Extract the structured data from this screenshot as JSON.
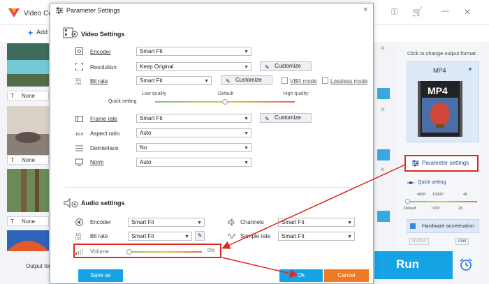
{
  "app": {
    "title": "Video Co",
    "add_files": "Add F",
    "thumb_none_label": "None",
    "output_folder": "Output fold",
    "right_panel": {
      "click_to_change": "Click to change output format:",
      "format": "MP4",
      "format_badge": "MP4",
      "parameter_settings": "Parameter settings",
      "quick_setting": "Quick setting",
      "quick_ticks_top": [
        "480P",
        "1080P",
        "4K"
      ],
      "quick_ticks_bottom": [
        "Default",
        "720P",
        "2K"
      ],
      "hardware_acceleration": "Hardware acceleration",
      "nvidia": "NVIDIA",
      "intel": "Intel"
    },
    "run": "Run"
  },
  "dialog": {
    "title": "Parameter Settings",
    "close": "×",
    "video": {
      "section": "Video Settings",
      "encoder": {
        "label": "Encoder",
        "value": "Smart Fit"
      },
      "resolution": {
        "label": "Resolution",
        "value": "Keep Original",
        "button": "Customize"
      },
      "bitrate": {
        "label": "Bit rate",
        "value": "Smart Fit",
        "button": "Customize",
        "vbr": "VBR mode",
        "lossless": "Lossless mode"
      },
      "quick": {
        "label": "Quick setting",
        "low": "Low quality",
        "default": "Default",
        "high": "High quality",
        "level": 0.5
      },
      "framerate": {
        "label": "Frame rate",
        "value": "Smart Fit",
        "button": "Customize"
      },
      "aspect": {
        "label": "Aspect ratio",
        "value": "Auto"
      },
      "deinterlace": {
        "label": "Deinterlace",
        "value": "No"
      },
      "norm": {
        "label": "Norm",
        "value": "Auto"
      }
    },
    "audio": {
      "section": "Audio settings",
      "encoder": {
        "label": "Encoder",
        "value": "Smart Fit"
      },
      "bitrate": {
        "label": "Bit rate",
        "value": "Smart Fit"
      },
      "channels": {
        "label": "Channels",
        "value": "Smart Fit"
      },
      "samplerate": {
        "label": "Sample rate",
        "value": "Smart Fit"
      },
      "volume": {
        "label": "Volume",
        "value": "0%",
        "level": 0.0
      }
    },
    "save_as": "Save as",
    "ok": "Ok",
    "cancel": "Cancel"
  },
  "colors": {
    "accent": "#16a3e6",
    "highlight": "#e0281f",
    "cancel": "#f07a23"
  }
}
